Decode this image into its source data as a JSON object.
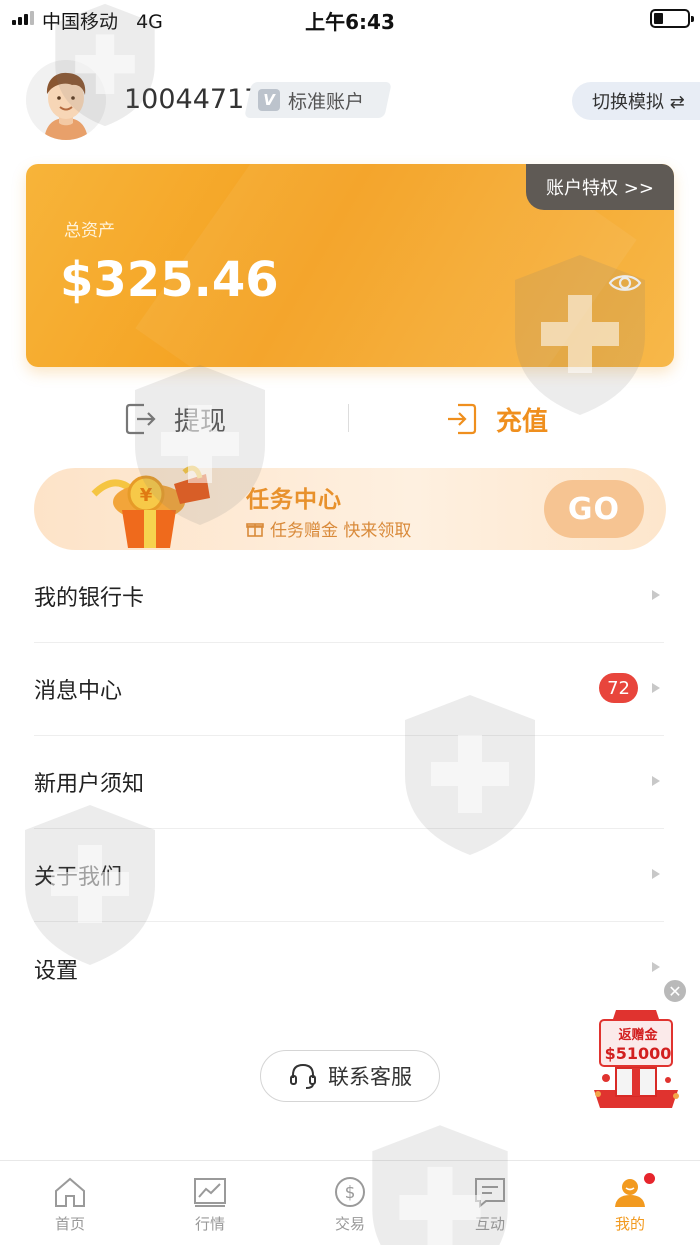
{
  "status_bar": {
    "carrier": "中国移动",
    "network": "4G",
    "time": "上午6:43"
  },
  "header": {
    "user_id": "10044717",
    "account_type": "标准账户",
    "switch_label": "切换模拟 ⇄"
  },
  "asset_card": {
    "privilege_label": "账户特权 >>",
    "total_assets_label": "总资产",
    "total_assets_value": "$325.46"
  },
  "actions": {
    "withdraw": "提现",
    "deposit": "充值"
  },
  "task_center": {
    "title": "任务中心",
    "subtitle": "任务赠金 快来领取",
    "go_label": "GO"
  },
  "menu": {
    "items": [
      {
        "label": "我的银行卡"
      },
      {
        "label": "消息中心",
        "badge": "72"
      },
      {
        "label": "新用户须知"
      },
      {
        "label": "关于我们"
      },
      {
        "label": "设置"
      }
    ]
  },
  "contact": {
    "label": "联系客服"
  },
  "promo": {
    "line1": "返赠金",
    "line2": "$51000"
  },
  "tabbar": {
    "tabs": [
      {
        "label": "首页",
        "icon": "home-icon"
      },
      {
        "label": "行情",
        "icon": "chart-icon"
      },
      {
        "label": "交易",
        "icon": "dollar-icon"
      },
      {
        "label": "互动",
        "icon": "message-icon"
      },
      {
        "label": "我的",
        "icon": "profile-icon",
        "active": true
      }
    ]
  },
  "colors": {
    "accent": "#f29a1f",
    "card": "#f4a01f",
    "badge": "#e8453c"
  }
}
